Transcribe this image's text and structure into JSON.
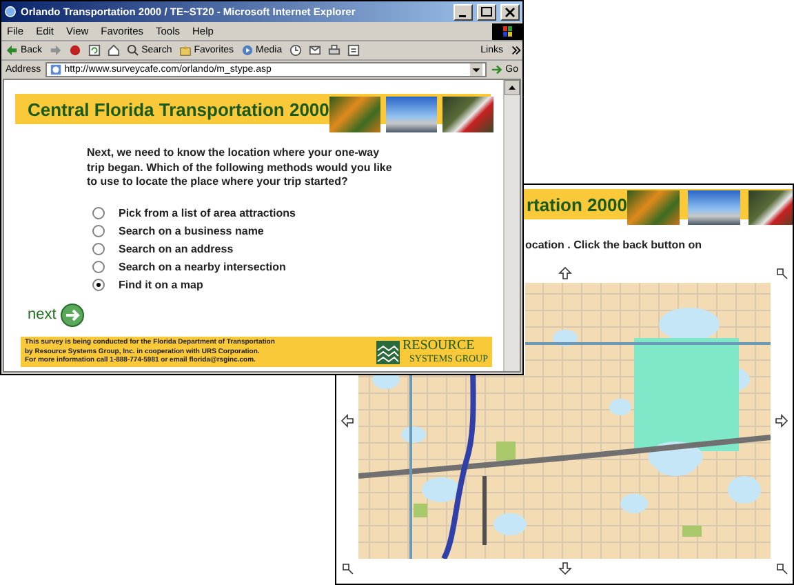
{
  "browser": {
    "title": "Orlando Transportation 2000 / TE~ST20 - Microsoft Internet Explorer",
    "menu": [
      "File",
      "Edit",
      "View",
      "Favorites",
      "Tools",
      "Help"
    ],
    "toolbar": {
      "back": "Back",
      "search": "Search",
      "favorites": "Favorites",
      "media": "Media",
      "links": "Links"
    },
    "address_label": "Address",
    "url": "http://www.surveycafe.com/orlando/m_stype.asp",
    "go": "Go"
  },
  "page": {
    "banner_title": "Central Florida Transportation 2000",
    "question": "Next, we need to know the location where your one-way trip began. Which of the following methods would you like to use to locate the place where your trip started?",
    "options": [
      {
        "label": "Pick from a list of area attractions",
        "selected": false
      },
      {
        "label": "Search on a business name",
        "selected": false
      },
      {
        "label": "Search on an address",
        "selected": false
      },
      {
        "label": "Search on a nearby intersection",
        "selected": false
      },
      {
        "label": "Find it on a map",
        "selected": true
      }
    ],
    "next": "next",
    "footer_lines": [
      "This survey is being conducted for the Florida Department of Transportation",
      "by Resource Systems Group, Inc. in cooperation with URS Corporation.",
      "For more information call 1-888-774-5981 or email florida@rsginc.com."
    ],
    "logo": {
      "line_1": "RESOURCE",
      "line_2": "SYSTEMS GROUP"
    }
  },
  "map_window": {
    "banner_title": "rtation 2000",
    "instruction": "ocation . Click the back button on"
  }
}
